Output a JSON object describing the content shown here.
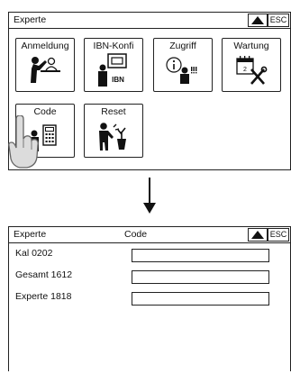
{
  "screen1": {
    "title": "Experte",
    "esc_label": "ESC",
    "tiles": [
      {
        "label": "Anmeldung"
      },
      {
        "label": "IBN-Konfi",
        "icon_text": "IBN"
      },
      {
        "label": "Zugriff"
      },
      {
        "label": "Wartung"
      },
      {
        "label": "Code"
      },
      {
        "label": "Reset"
      }
    ]
  },
  "screen2": {
    "title": "Experte",
    "subtitle": "Code",
    "esc_label": "ESC",
    "rows": [
      {
        "label": "Kal 0202"
      },
      {
        "label": "Gesamt 1612"
      },
      {
        "label": "Experte 1818"
      }
    ]
  }
}
